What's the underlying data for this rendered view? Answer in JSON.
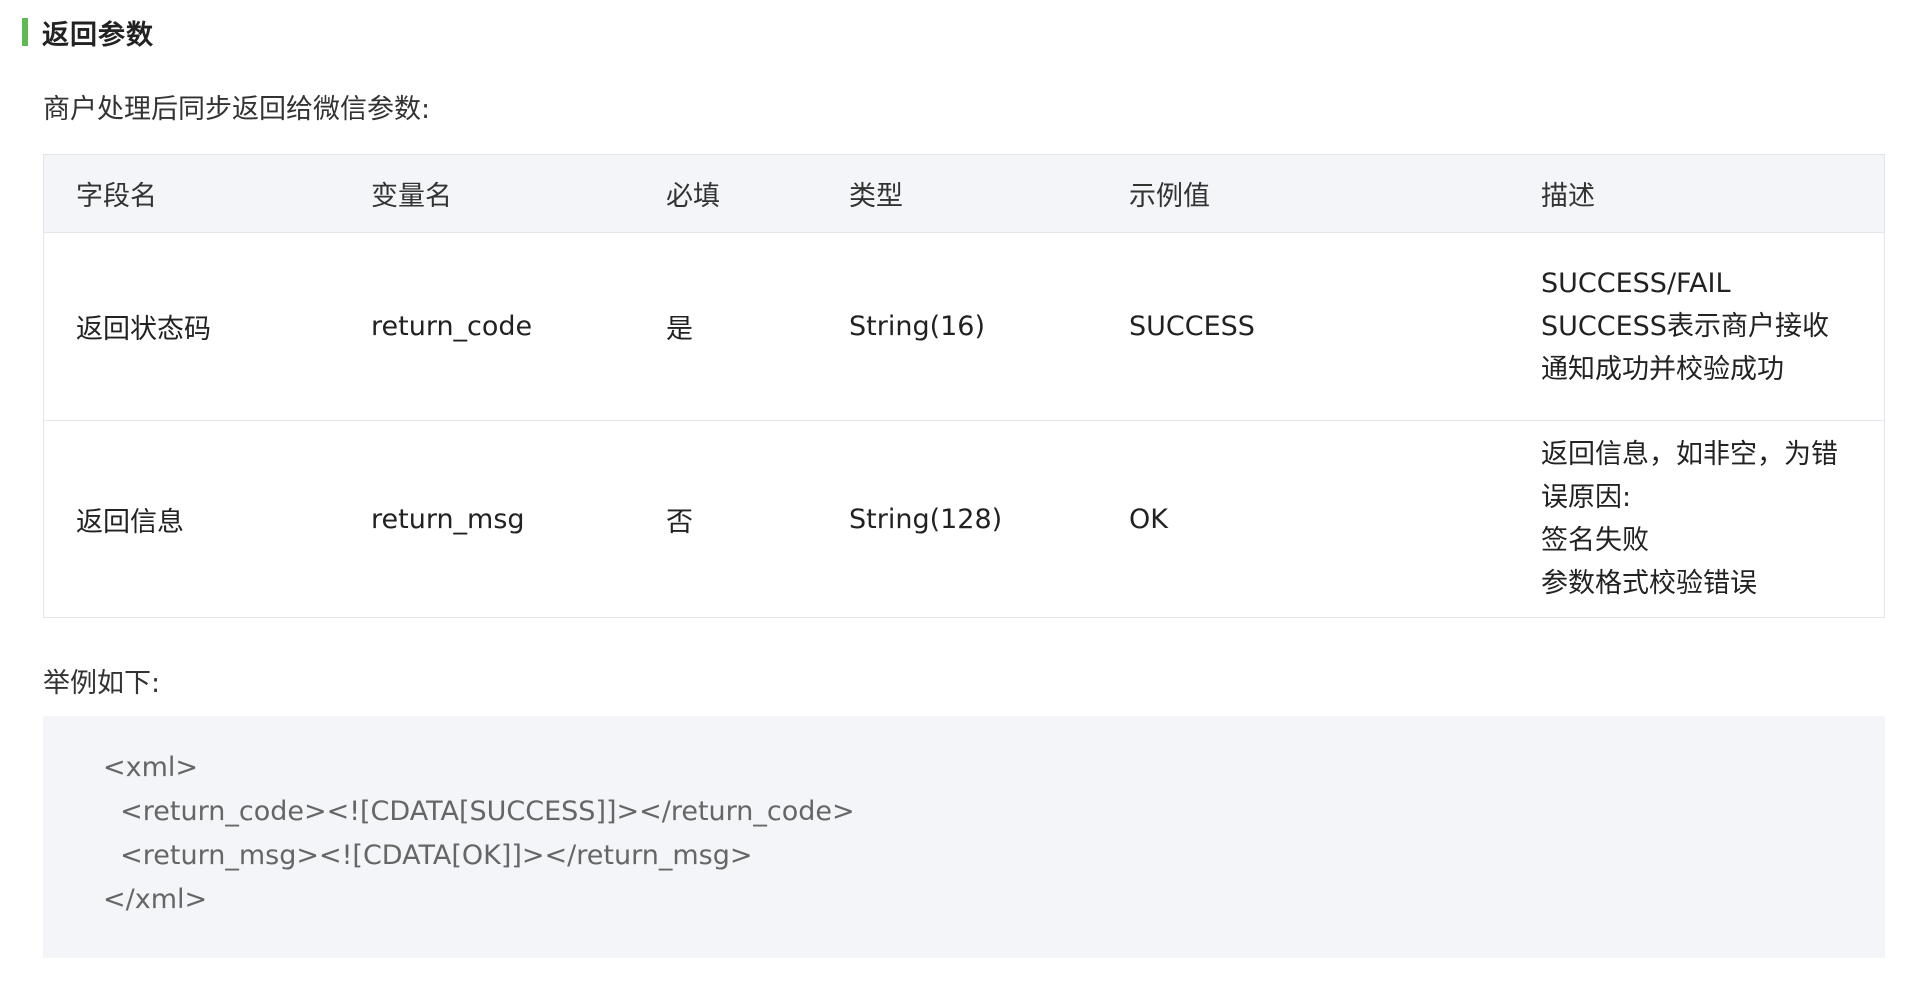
{
  "section": {
    "title": "返回参数",
    "accent_color": "#5fb954"
  },
  "intro": "商户处理后同步返回给微信参数:",
  "table": {
    "headers": [
      "字段名",
      "变量名",
      "必填",
      "类型",
      "示例值",
      "描述"
    ],
    "rows": [
      {
        "field": "返回状态码",
        "variable": "return_code",
        "required": "是",
        "type": "String(16)",
        "example": "SUCCESS",
        "description": [
          "SUCCESS/FAIL",
          "SUCCESS表示商户接收通知成功并校验成功"
        ]
      },
      {
        "field": "返回信息",
        "variable": "return_msg",
        "required": "否",
        "type": "String(128)",
        "example": "OK",
        "description": [
          "返回信息，如非空，为错误原因:",
          "签名失败",
          "参数格式校验错误"
        ]
      }
    ]
  },
  "example_label": "举例如下:",
  "code": [
    "<xml>",
    "  <return_code><![CDATA[SUCCESS]]></return_code>",
    "  <return_msg><![CDATA[OK]]></return_msg>",
    "</xml>"
  ]
}
